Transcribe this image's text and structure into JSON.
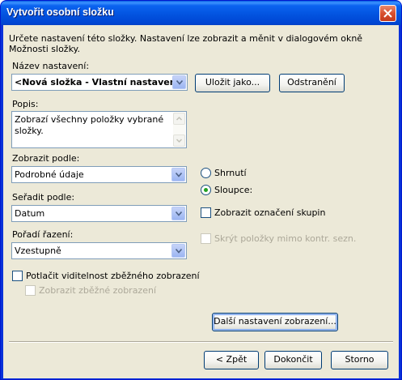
{
  "window": {
    "title": "Vytvořit osobní složku"
  },
  "intro_text_line1": "Určete nastavení této složky. Nastavení lze zobrazit a měnit v dialogovém okně",
  "intro_text_line2": "Možnosti složky.",
  "settings_name": {
    "label": "Název nastavení:",
    "value": "<Nová složka - Vlastní nastavení>"
  },
  "buttons": {
    "save_as": "Uložit jako...",
    "remove": "Odstranění",
    "more_view_settings": "Další nastavení zobrazení...",
    "back": "< Zpět",
    "finish": "Dokončit",
    "cancel": "Storno"
  },
  "description": {
    "label": "Popis:",
    "text": "Zobrazí všechny položky vybrané složky."
  },
  "view_by": {
    "label": "Zobrazit podle:",
    "value": "Podrobné údaje"
  },
  "sort_by": {
    "label": "Seřadit podle:",
    "value": "Datum"
  },
  "sort_order": {
    "label": "Pořadí řazení:",
    "value": "Vzestupně"
  },
  "radios": {
    "summary": "Shrnutí",
    "columns": "Sloupce:",
    "selected": "columns"
  },
  "checkboxes": {
    "show_group_labels": "Zobrazit označení skupin",
    "hide_items_outside": "Skrýt položky mimo kontr. sezn.",
    "suppress_current_view": "Potlačit viditelnost zběžného zobrazení",
    "show_current_view": "Zobrazit zběžné zobrazení"
  },
  "colors": {
    "title_bar": "#0a5fe5",
    "dialog_bg": "#ece9d8",
    "close_button": "#d8502f",
    "radio_dot": "#21a121",
    "disabled_text": "#aca899"
  }
}
